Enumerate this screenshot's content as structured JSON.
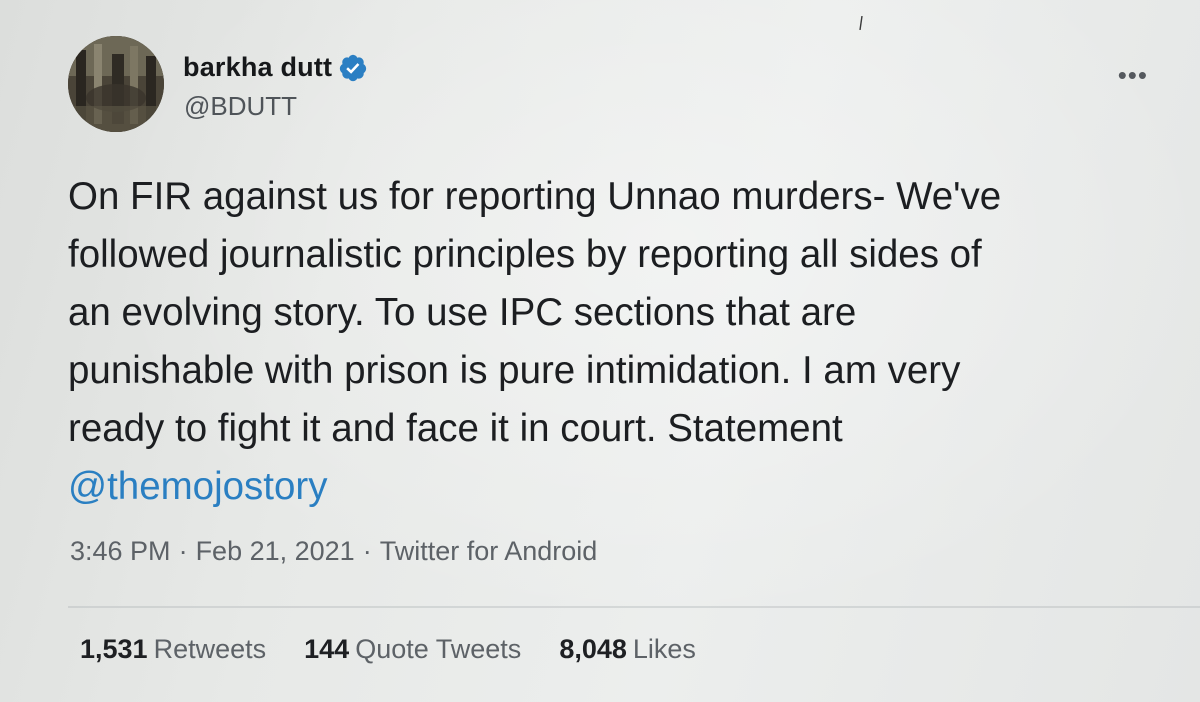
{
  "tweet": {
    "author": {
      "display_name": "barkha dutt",
      "handle": "@BDUTT",
      "verified": true,
      "avatar_icon": "avatar-photo"
    },
    "more_icon": "•••",
    "text_lines": [
      "On FIR against us for reporting Unnao murders- We've",
      "followed journalistic principles by reporting all sides of",
      "an evolving story. To use IPC sections that are",
      "punishable with prison is pure intimidation. I am very",
      "ready to fight it and face it in court. Statement"
    ],
    "mention": "@themojostory",
    "meta": {
      "time": "3:46 PM",
      "date": "Feb 21, 2021",
      "separator": "·",
      "source": "Twitter for Android"
    },
    "stats": {
      "retweets": {
        "count": "1,531",
        "label": "Retweets"
      },
      "quote_tweets": {
        "count": "144",
        "label": "Quote Tweets"
      },
      "likes": {
        "count": "8,048",
        "label": "Likes"
      }
    }
  },
  "colors": {
    "mention": "#2a7fc2",
    "verified": "#2b7fc3",
    "secondary_text": "#5d6267"
  }
}
